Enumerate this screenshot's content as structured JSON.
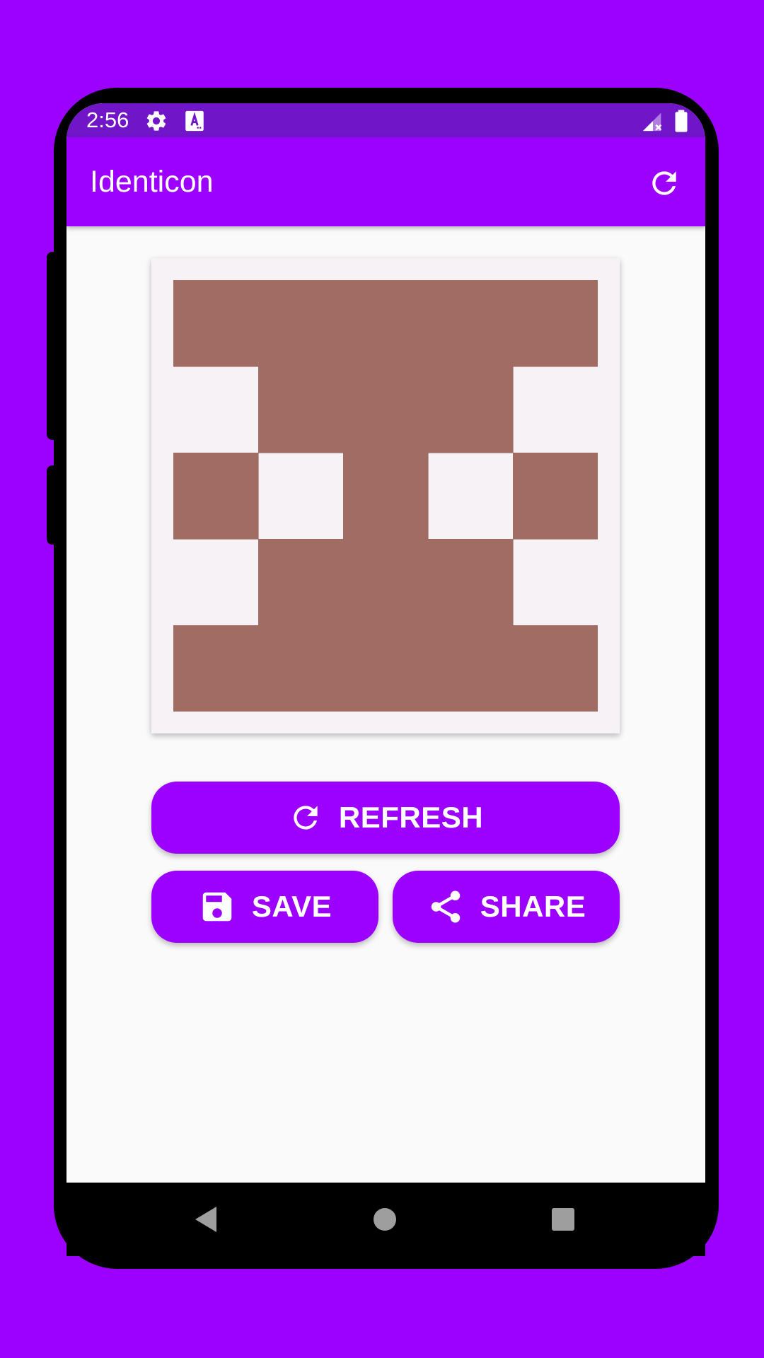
{
  "status_bar": {
    "time": "2:56",
    "icons": [
      "gear-icon",
      "text-a-icon",
      "signal-icon",
      "battery-icon"
    ]
  },
  "app_bar": {
    "title": "Identicon",
    "action_icon": "refresh-icon"
  },
  "identicon": {
    "color": "#a06c64",
    "background": "#f6f2f6",
    "grid": [
      [
        1,
        1,
        1,
        1,
        1
      ],
      [
        0,
        1,
        1,
        1,
        0
      ],
      [
        1,
        0,
        1,
        0,
        1
      ],
      [
        0,
        1,
        1,
        1,
        0
      ],
      [
        1,
        1,
        1,
        1,
        1
      ]
    ]
  },
  "buttons": {
    "refresh_label": "REFRESH",
    "save_label": "SAVE",
    "share_label": "SHARE"
  },
  "nav_bar": {
    "icons": [
      "back-icon",
      "home-icon",
      "recents-icon"
    ]
  },
  "colors": {
    "accent": "#9c00ff",
    "status_bar": "#7015c8"
  }
}
